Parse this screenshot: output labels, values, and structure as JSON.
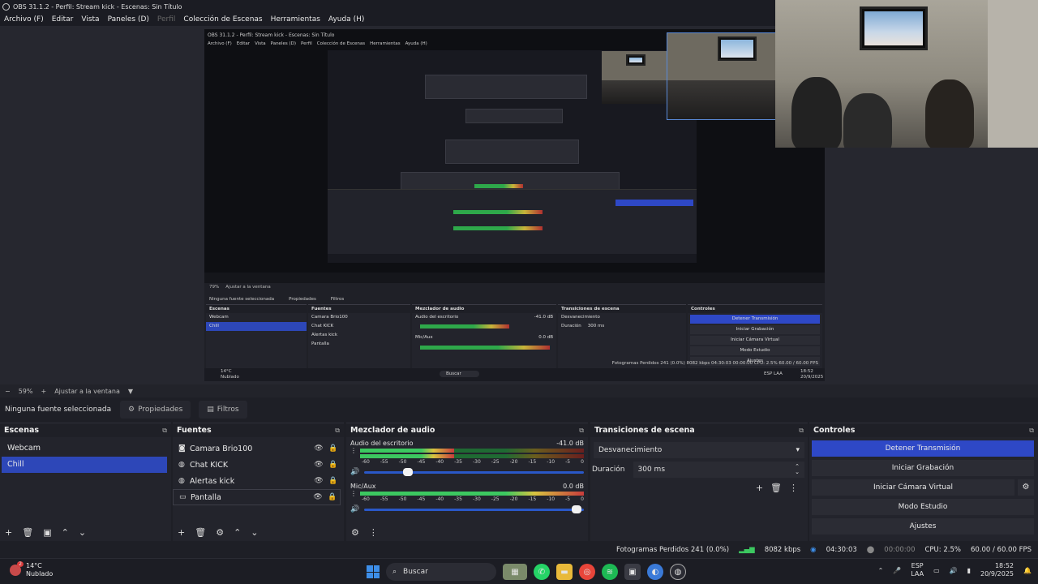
{
  "window": {
    "title": "OBS 31.1.2 - Perfil: Stream kick - Escenas: Sin Título"
  },
  "menu": {
    "items": [
      {
        "label": "Archivo (F)",
        "enabled": true
      },
      {
        "label": "Editar",
        "enabled": true
      },
      {
        "label": "Vista",
        "enabled": true
      },
      {
        "label": "Paneles (D)",
        "enabled": true
      },
      {
        "label": "Perfil",
        "enabled": false
      },
      {
        "label": "Colección de Escenas",
        "enabled": true
      },
      {
        "label": "Herramientas",
        "enabled": true
      },
      {
        "label": "Ayuda (H)",
        "enabled": true
      }
    ]
  },
  "preview": {
    "inner_title": "OBS 31.1.2 - Perfil: Stream kick - Escenas: Sin Título",
    "inner_menu": [
      "Archivo (F)",
      "Editar",
      "Vista",
      "Paneles (D)",
      "Perfil",
      "Colección de Escenas",
      "Herramientas",
      "Ayuda (H)"
    ],
    "inner_zoom": "79%",
    "inner_fit": "Ajustar a la ventana",
    "inner_none": "Ninguna fuente seleccionada",
    "inner_props": "Propiedades",
    "inner_filters": "Filtros",
    "inner_scenes_title": "Escenas",
    "inner_scenes": [
      "Webcam",
      "Chill"
    ],
    "inner_sources_title": "Fuentes",
    "inner_sources": [
      "Camara Brio100",
      "Chat KICK",
      "Alertas kick",
      "Pantalla"
    ],
    "inner_mixer_title": "Mezclador de audio",
    "inner_mixer_ch1": "Audio del escritorio",
    "inner_mixer_ch1_db": "-41.0 dB",
    "inner_mixer_ch2": "Mic/Aux",
    "inner_mixer_ch2_db": "0.0 dB",
    "inner_trans_title": "Transiciones de escena",
    "inner_trans_value": "Desvanecimiento",
    "inner_dur_label": "Duración",
    "inner_dur_value": "300 ms",
    "inner_controls_title": "Controles",
    "inner_controls": [
      "Detener Transmisión",
      "Iniciar Grabación",
      "Iniciar Cámara Virtual",
      "Modo Estudio",
      "Ajustes"
    ],
    "inner_status": "Fotogramas Perdidos 241 (0.0%)   8082 kbps   04:30:03   00:00:00   CPU: 2.5%   60.00 / 60.00 FPS",
    "inner_weather_temp": "14°C",
    "inner_weather_desc": "Nublado",
    "inner_search": "Buscar",
    "inner_lang": "ESP LAA",
    "inner_time": "18:52",
    "inner_date": "20/9/2025"
  },
  "zoom": {
    "minus": "−",
    "value": "59%",
    "plus": "+",
    "fit": "Ajustar a la ventana",
    "arrow": "▼"
  },
  "source_bar": {
    "none_selected": "Ninguna fuente seleccionada",
    "properties": "Propiedades",
    "filters": "Filtros"
  },
  "scenes": {
    "title": "Escenas",
    "items": [
      {
        "label": "Webcam",
        "selected": false
      },
      {
        "label": "Chill",
        "selected": true
      }
    ]
  },
  "sources": {
    "title": "Fuentes",
    "items": [
      {
        "label": "Camara Brio100",
        "icon": "camera-icon"
      },
      {
        "label": "Chat KICK",
        "icon": "globe-icon"
      },
      {
        "label": "Alertas kick",
        "icon": "globe-icon"
      },
      {
        "label": "Pantalla",
        "icon": "monitor-icon"
      }
    ]
  },
  "mixer": {
    "title": "Mezclador de audio",
    "channels": [
      {
        "name": "Audio del escritorio",
        "db": "-41.0 dB",
        "level": 0.42,
        "fader": 0.22
      },
      {
        "name": "Mic/Aux",
        "db": "0.0 dB",
        "level": 1.0,
        "fader": 0.99
      }
    ],
    "scale": [
      "-60",
      "-55",
      "-50",
      "-45",
      "-40",
      "-35",
      "-30",
      "-25",
      "-20",
      "-15",
      "-10",
      "-5",
      "0"
    ]
  },
  "transitions": {
    "title": "Transiciones de escena",
    "selected": "Desvanecimiento",
    "duration_label": "Duración",
    "duration_value": "300 ms"
  },
  "controls": {
    "title": "Controles",
    "stop_stream": "Detener Transmisión",
    "start_recording": "Iniciar Grabación",
    "start_virtual_cam": "Iniciar Cámara Virtual",
    "studio_mode": "Modo Estudio",
    "settings": "Ajustes"
  },
  "status": {
    "dropped_frames": "Fotogramas Perdidos 241 (0.0%)",
    "bitrate": "8082 kbps",
    "stream_time": "04:30:03",
    "rec_time": "00:00:00",
    "cpu": "CPU: 2.5%",
    "fps": "60.00 / 60.00 FPS"
  },
  "taskbar": {
    "weather_temp": "14°C",
    "weather_desc": "Nublado",
    "weather_badge": "2",
    "search_placeholder": "Buscar",
    "lang_top": "ESP",
    "lang_bottom": "LAA",
    "time": "18:52",
    "date": "20/9/2025"
  },
  "colors": {
    "accent": "#2d47b8",
    "button_blue": "#2e48c6",
    "meter_green": "#3cc860",
    "meter_yellow": "#d8c340",
    "meter_red": "#c83c3c"
  }
}
